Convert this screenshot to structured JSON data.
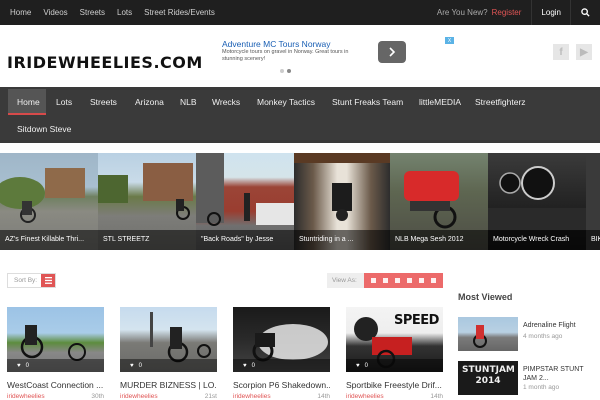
{
  "topbar": {
    "links": [
      "Home",
      "Videos",
      "Streets",
      "Lots",
      "Street Rides/Events"
    ],
    "new_question": "Are You New?",
    "register_label": "Register",
    "login_label": "Login",
    "search_icon": "search-icon"
  },
  "header": {
    "logo": "IRIDEWHEELIES.COM",
    "ad": {
      "title": "Adventure MC Tours Norway",
      "text": "Motorcycle tours on gravel in Norway. Great tours in stunning scenery!",
      "close_label": "X"
    },
    "social": [
      {
        "icon": "facebook-icon",
        "glyph": "f"
      },
      {
        "icon": "youtube-icon",
        "glyph": "▶"
      }
    ]
  },
  "mainnav": {
    "items": [
      "Home",
      "Lots",
      "Streets",
      "Arizona",
      "NLB",
      "Wrecks",
      "Monkey Tactics",
      "Stunt Freaks Team",
      "littleMEDIA",
      "Streetfighterz",
      "Sitdown Steve"
    ]
  },
  "slides": [
    {
      "caption": "AZ's Finest Killable Thri..."
    },
    {
      "caption": "STL STREETZ"
    },
    {
      "caption": "\"Back Roads\" by Jesse"
    },
    {
      "caption": "Stuntriding in a ..."
    },
    {
      "caption": "NLB Mega Sesh 2012"
    },
    {
      "caption": "Motorcycle Wreck Crash"
    },
    {
      "caption": "BIK"
    }
  ],
  "toolbar": {
    "sort_label": "Sort By:",
    "view_label": "View As:"
  },
  "cards": [
    {
      "title": "WestCoast Connection ...",
      "author": "iridewheelies",
      "date": "30th",
      "likes": "0"
    },
    {
      "title": "MURDER BIZNESS | LO...",
      "author": "iridewheelies",
      "date": "21st",
      "likes": "0"
    },
    {
      "title": "Scorpion P6 Shakedown...",
      "author": "iridewheelies",
      "date": "14th",
      "likes": "0"
    },
    {
      "title": "Sportbike Freestyle Drif...",
      "author": "iridewheelies",
      "date": "14th",
      "likes": "0"
    }
  ],
  "card4_overlay": "SPEED",
  "most_viewed": {
    "title": "Most Viewed",
    "items": [
      {
        "name": "Adrenaline Flight",
        "time": "4 months ago"
      },
      {
        "name": "PIMPSTAR STUNT JAM 2...",
        "time": "1 month ago",
        "thumb_text": "STUNTJAM 2014"
      }
    ]
  }
}
